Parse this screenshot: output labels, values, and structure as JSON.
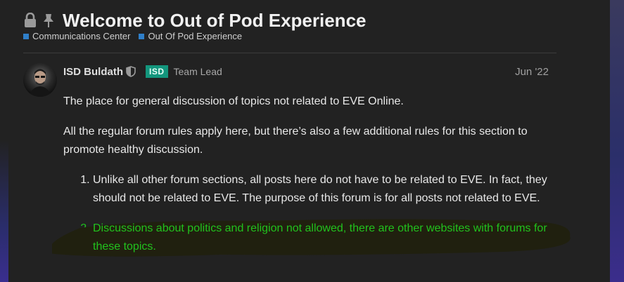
{
  "topic": {
    "title": "Welcome to Out of Pod Experience",
    "icons": [
      "lock-icon",
      "pin-icon"
    ]
  },
  "breadcrumbs": [
    {
      "label": "Communications Center",
      "color": "#2f7fc9"
    },
    {
      "label": "Out Of Pod Experience",
      "color": "#2f7fc9"
    }
  ],
  "post": {
    "author": "ISD Buldath",
    "flair": "ISD",
    "flair_color": "#13967d",
    "user_title": "Team Lead",
    "date": "Jun '22",
    "paragraphs": [
      "The place for general discussion of topics not related to EVE Online.",
      "All the regular forum rules apply here, but there’s also a few additional rules for this section to promote healthy discussion."
    ],
    "rules": [
      "Unlike all other forum sections, all posts here do not have to be related to EVE. In fact, they should not be related to EVE. The purpose of this forum is for all posts not related to EVE.",
      "Discussions about politics and religion not allowed, there are other websites with forums for these topics."
    ]
  },
  "highlight_color": "#21c21d"
}
